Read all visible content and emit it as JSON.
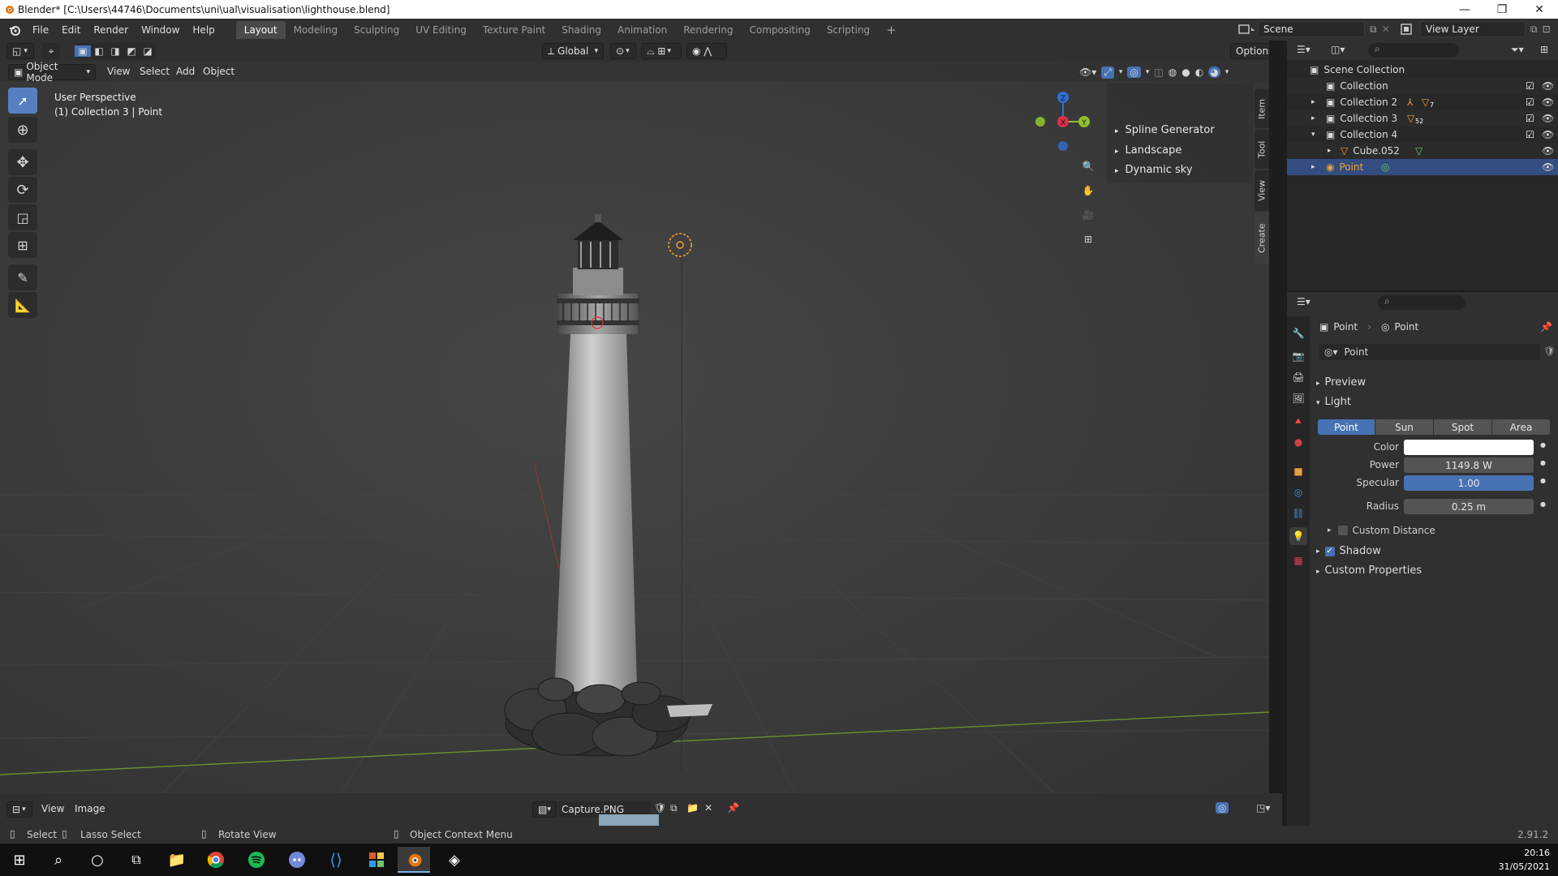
{
  "window": {
    "title": "Blender* [C:\\Users\\44746\\Documents\\uni\\ual\\visualisation\\lighthouse.blend]",
    "controls": [
      "—",
      "❐",
      "✕"
    ]
  },
  "menu": {
    "items": [
      "File",
      "Edit",
      "Render",
      "Window",
      "Help"
    ]
  },
  "workspaces": {
    "tabs": [
      "Layout",
      "Modeling",
      "Sculpting",
      "UV Editing",
      "Texture Paint",
      "Shading",
      "Animation",
      "Rendering",
      "Compositing",
      "Scripting"
    ],
    "active": "Layout",
    "add": "+"
  },
  "scene": {
    "name": "Scene",
    "view_layer": "View Layer"
  },
  "viewport": {
    "mode": "Object Mode",
    "menus": [
      "View",
      "Select",
      "Add",
      "Object"
    ],
    "orientation": "Global",
    "options": "Options",
    "info_line1": "User Perspective",
    "info_line2": "(1) Collection 3 | Point",
    "gizmo": {
      "z": "Z",
      "x": "X",
      "y": "Y"
    },
    "npanel_items": [
      "Spline Generator",
      "Landscape",
      "Dynamic sky"
    ],
    "npanel_tabs": [
      "Item",
      "Tool",
      "View",
      "Create"
    ],
    "colors": {
      "bg": "#3d3d3d",
      "grid_x": "#8a3a3a",
      "grid_y": "#6b8e2f",
      "light": "#f0a030"
    }
  },
  "image_editor": {
    "menus": [
      "View",
      "Image"
    ],
    "image_name": "Capture.PNG"
  },
  "status": {
    "select": "Select",
    "lasso": "Lasso Select",
    "rotate": "Rotate View",
    "context": "Object Context Menu",
    "version": "2.91.2"
  },
  "taskbar": {
    "time": "20:16",
    "date": "31/05/2021"
  },
  "outliner": {
    "root": "Scene Collection",
    "rows": [
      {
        "name": "Collection",
        "indent": 1
      },
      {
        "name": "Collection 2",
        "indent": 1
      },
      {
        "name": "Collection 3",
        "indent": 1
      },
      {
        "name": "Collection 4",
        "indent": 1
      },
      {
        "name": "Cube.052",
        "indent": 2
      },
      {
        "name": "Point",
        "indent": 1
      }
    ],
    "badge_collection3": "52",
    "badge_collection2": "7"
  },
  "properties": {
    "breadcrumb": [
      "Point",
      "Point"
    ],
    "datablock": "Point",
    "sections": {
      "preview": "Preview",
      "light": "Light",
      "shadow": "Shadow",
      "custom_props": "Custom Properties"
    },
    "light_types": [
      "Point",
      "Sun",
      "Spot",
      "Area"
    ],
    "active_type": "Point",
    "fields": {
      "color_label": "Color",
      "power_label": "Power",
      "power_value": "1149.8 W",
      "specular_label": "Specular",
      "specular_value": "1.00",
      "radius_label": "Radius",
      "radius_value": "0.25 m"
    },
    "custom_distance": "Custom Distance",
    "shadow_checked": true,
    "color_value": "#ffffff"
  }
}
